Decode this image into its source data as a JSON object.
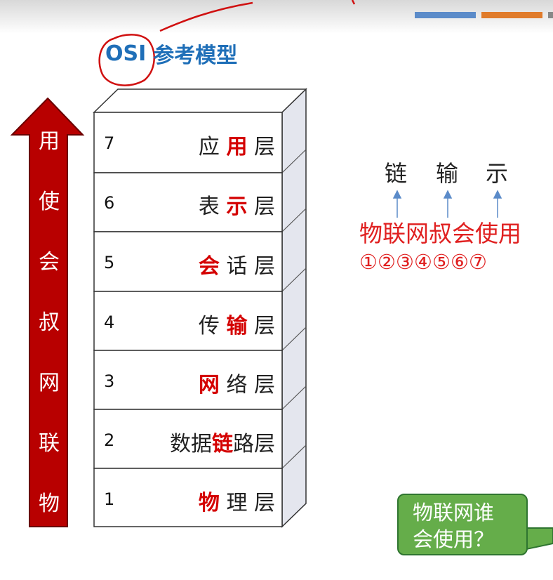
{
  "title": {
    "osi": "OSI",
    "rest": "参考模型"
  },
  "arrow_chars": [
    "用",
    "使",
    "会",
    "叔",
    "网",
    "联",
    "物"
  ],
  "layers": [
    {
      "num": "7",
      "parts": [
        {
          "t": "应 ",
          "hl": false
        },
        {
          "t": "用",
          "hl": true
        },
        {
          "t": " 层",
          "hl": false
        }
      ]
    },
    {
      "num": "6",
      "parts": [
        {
          "t": "表 ",
          "hl": false
        },
        {
          "t": "示",
          "hl": true
        },
        {
          "t": " 层",
          "hl": false
        }
      ]
    },
    {
      "num": "5",
      "parts": [
        {
          "t": "会",
          "hl": true
        },
        {
          "t": " 话 层",
          "hl": false
        }
      ]
    },
    {
      "num": "4",
      "parts": [
        {
          "t": "传 ",
          "hl": false
        },
        {
          "t": "输",
          "hl": true
        },
        {
          "t": " 层",
          "hl": false
        }
      ]
    },
    {
      "num": "3",
      "parts": [
        {
          "t": "网",
          "hl": true
        },
        {
          "t": " 络 层",
          "hl": false
        }
      ]
    },
    {
      "num": "2",
      "parts": [
        {
          "t": "数据",
          "hl": false
        },
        {
          "t": "链",
          "hl": true
        },
        {
          "t": "路层",
          "hl": false
        }
      ]
    },
    {
      "num": "1",
      "parts": [
        {
          "t": "物",
          "hl": true
        },
        {
          "t": " 理 层",
          "hl": false
        }
      ]
    }
  ],
  "mnemonic": {
    "keywords": [
      "链",
      "输",
      "示"
    ],
    "phrase": "物联网叔会使用",
    "numbers": "①②③④⑤⑥⑦"
  },
  "callout": {
    "line1": "物联网谁",
    "line2": "会使用？"
  },
  "colors": {
    "title": "#1f6fb8",
    "highlight": "#d40000",
    "arrow_fill": "#b80000",
    "mnemonic": "#e02020",
    "callout_fill": "#65ad4a",
    "accent_blue": "#5b8bc9",
    "accent_orange": "#e07b2a"
  }
}
